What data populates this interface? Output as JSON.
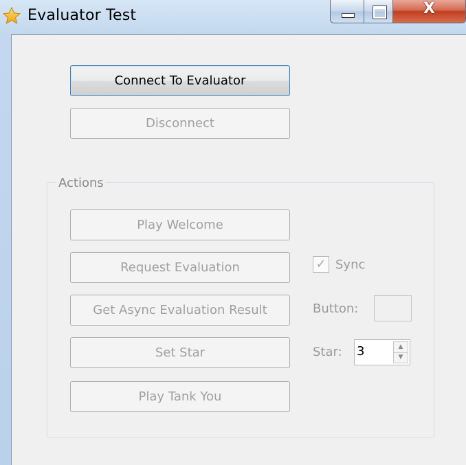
{
  "window": {
    "title": "Evaluator Test",
    "close_glyph": "X"
  },
  "main": {
    "connect_label": "Connect To Evaluator",
    "disconnect_label": "Disconnect"
  },
  "actions": {
    "group_label": "Actions",
    "play_welcome_label": "Play Welcome",
    "request_evaluation_label": "Request Evaluation",
    "get_async_result_label": "Get Async Evaluation Result",
    "set_star_label": "Set Star",
    "play_tank_you_label": "Play Tank You",
    "sync_label": "Sync",
    "sync_checked": true,
    "sync_check_glyph": "✓",
    "button_label": "Button:",
    "button_value": "",
    "star_label": "Star:",
    "star_value": "3",
    "spin_up_glyph": "▲",
    "spin_down_glyph": "▼"
  },
  "icons": {
    "app_icon": "star-icon",
    "minimize": "minimize-icon",
    "maximize": "maximize-icon",
    "close": "close-icon"
  },
  "colors": {
    "focus_border": "#3c7fb1",
    "disabled_text": "#a0a0a0",
    "close_red": "#c13f20",
    "star_gold": "#f5b21a"
  }
}
